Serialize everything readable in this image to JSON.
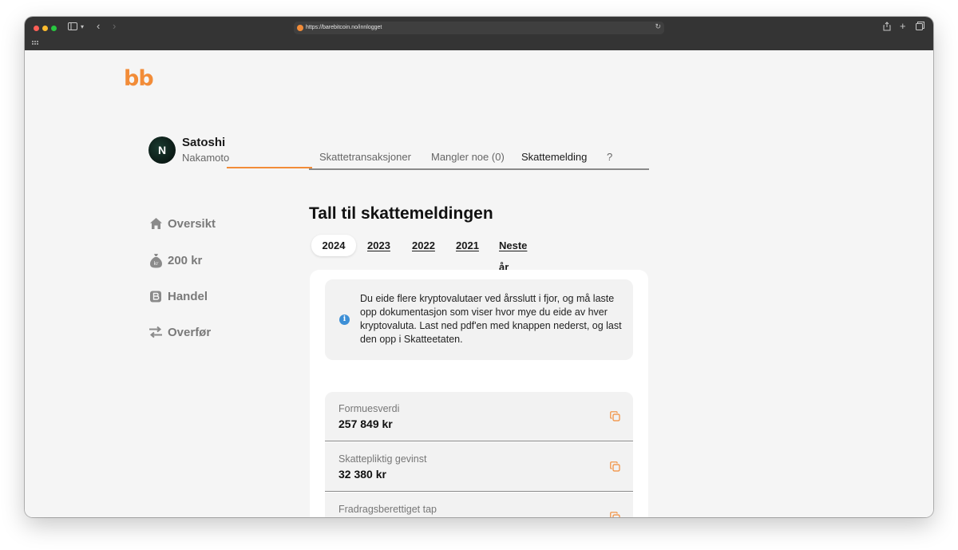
{
  "browser": {
    "url": "https://barebitcoin.no/innlogget"
  },
  "app": {
    "logo": "bb"
  },
  "user": {
    "initial": "N",
    "first_name": "Satoshi",
    "last_name": "Nakamoto"
  },
  "sidebar": {
    "items": [
      {
        "label": "Oversikt",
        "icon": "home-icon"
      },
      {
        "label": "200 kr",
        "icon": "money-bag-icon"
      },
      {
        "label": "Handel",
        "icon": "bitcoin-icon"
      },
      {
        "label": "Overfør",
        "icon": "transfer-icon"
      }
    ]
  },
  "tabs": {
    "items": [
      {
        "label": "Skattetransaksjoner"
      },
      {
        "label": "Mangler noe (0)"
      },
      {
        "label": "Skattemelding",
        "active": true
      },
      {
        "label": "?"
      }
    ]
  },
  "main": {
    "heading": "Tall til skattemeldingen",
    "years": [
      "2024",
      "2023",
      "2022",
      "2021",
      "Neste år"
    ],
    "active_year": "2024",
    "info_text": "Du eide flere kryptovalutaer ved årsslutt i fjor, og må laste opp dokumentasjon som viser hvor mye du eide av hver kryptovaluta. Last ned pdf'en med knappen nederst, og last den opp i Skatteetaten.",
    "fields": [
      {
        "label": "Formuesverdi",
        "value": "257 849 kr"
      },
      {
        "label": "Skattepliktig gevinst",
        "value": "32 380 kr"
      },
      {
        "label": "Fradragsberettiget tap",
        "value": ""
      }
    ]
  },
  "colors": {
    "accent": "#f28c38",
    "info_blue": "#3d8fd6"
  }
}
